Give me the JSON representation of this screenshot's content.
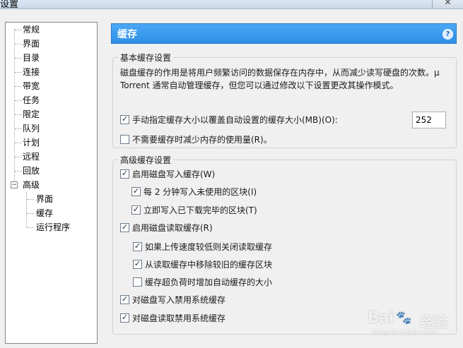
{
  "window": {
    "title": "设置",
    "close_label": "✕"
  },
  "sidebar": {
    "items": [
      {
        "label": "常规"
      },
      {
        "label": "界面"
      },
      {
        "label": "目录"
      },
      {
        "label": "连接"
      },
      {
        "label": "带宽"
      },
      {
        "label": "任务"
      },
      {
        "label": "限定"
      },
      {
        "label": "队列"
      },
      {
        "label": "计划"
      },
      {
        "label": "远程"
      },
      {
        "label": "回放"
      },
      {
        "label": "高级",
        "expanded": true,
        "expander": "−"
      }
    ],
    "children": [
      {
        "label": "界面"
      },
      {
        "label": "缓存"
      },
      {
        "label": "运行程序"
      }
    ]
  },
  "header": {
    "title": "缓存",
    "help": "?"
  },
  "basic": {
    "legend": "基本缓存设置",
    "desc1": "磁盘缓存的作用是将用户频繁访问的数据保存在内存中，从而减少读写硬盘的次数。μ",
    "desc2": "Torrent 通常自动管理缓存，但您可以通过修改以下设置更改其操作模式。",
    "options": [
      {
        "label": "手动指定缓存大小以覆盖自动设置的缓存大小(MB)(O):",
        "checked": true
      },
      {
        "label": "不需要缓存时减少内存的使用量(R)。",
        "checked": false
      }
    ],
    "cache_size_value": "252"
  },
  "advanced": {
    "legend": "高级缓存设置",
    "options": [
      {
        "label": "启用磁盘写入缓存(W)",
        "checked": true
      },
      {
        "label": "每 2 分钟写入未使用的区块(I)",
        "checked": true
      },
      {
        "label": "立即写入已下载完毕的区块(T)",
        "checked": true
      },
      {
        "label": "启用磁盘读取缓存(R)",
        "checked": true
      },
      {
        "label": "如果上传速度较低则关闭读取缓存",
        "checked": true
      },
      {
        "label": "从读取缓存中移除较旧的缓存区块",
        "checked": true
      },
      {
        "label": "缓存超负荷时增加自动缓存的大小",
        "checked": false
      },
      {
        "label": "对磁盘写入禁用系统缓存",
        "checked": true
      },
      {
        "label": "对磁盘读取禁用系统缓存",
        "checked": true
      }
    ]
  },
  "check_glyph": "✓",
  "watermark": {
    "brand": "Bai",
    "paw": "🐾",
    "suffix": "经验",
    "url": "jingyan.baidu.com"
  }
}
